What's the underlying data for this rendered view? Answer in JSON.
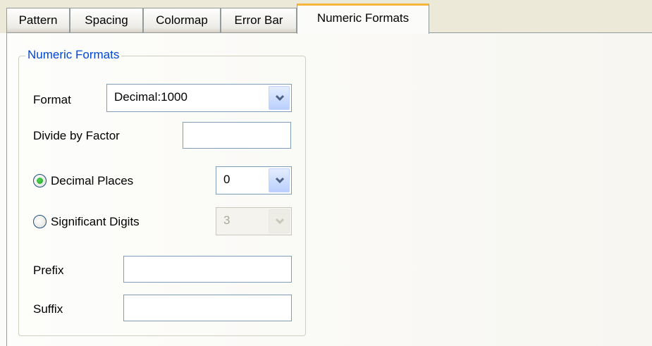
{
  "tabs": [
    {
      "label": "Pattern",
      "active": false
    },
    {
      "label": "Spacing",
      "active": false
    },
    {
      "label": "Colormap",
      "active": false
    },
    {
      "label": "Error Bar",
      "active": false
    },
    {
      "label": "Numeric Formats",
      "active": true
    }
  ],
  "group": {
    "title": "Numeric Formats",
    "format": {
      "label": "Format",
      "value": "Decimal:1000",
      "icon": "chevron-down-icon"
    },
    "divide_by_factor": {
      "label": "Divide by Factor",
      "value": ""
    },
    "decimal_places": {
      "label": "Decimal Places",
      "selected": true,
      "value": "0",
      "icon": "chevron-down-icon"
    },
    "significant_digits": {
      "label": "Significant Digits",
      "selected": false,
      "value": "3",
      "enabled": false,
      "icon": "chevron-down-icon"
    },
    "prefix": {
      "label": "Prefix",
      "value": ""
    },
    "suffix": {
      "label": "Suffix",
      "value": ""
    }
  },
  "colors": {
    "group_title": "#0046d5",
    "active_tab_accent": "#f6b53c",
    "radio_dot": "#21a121",
    "input_border": "#7f9db9"
  }
}
